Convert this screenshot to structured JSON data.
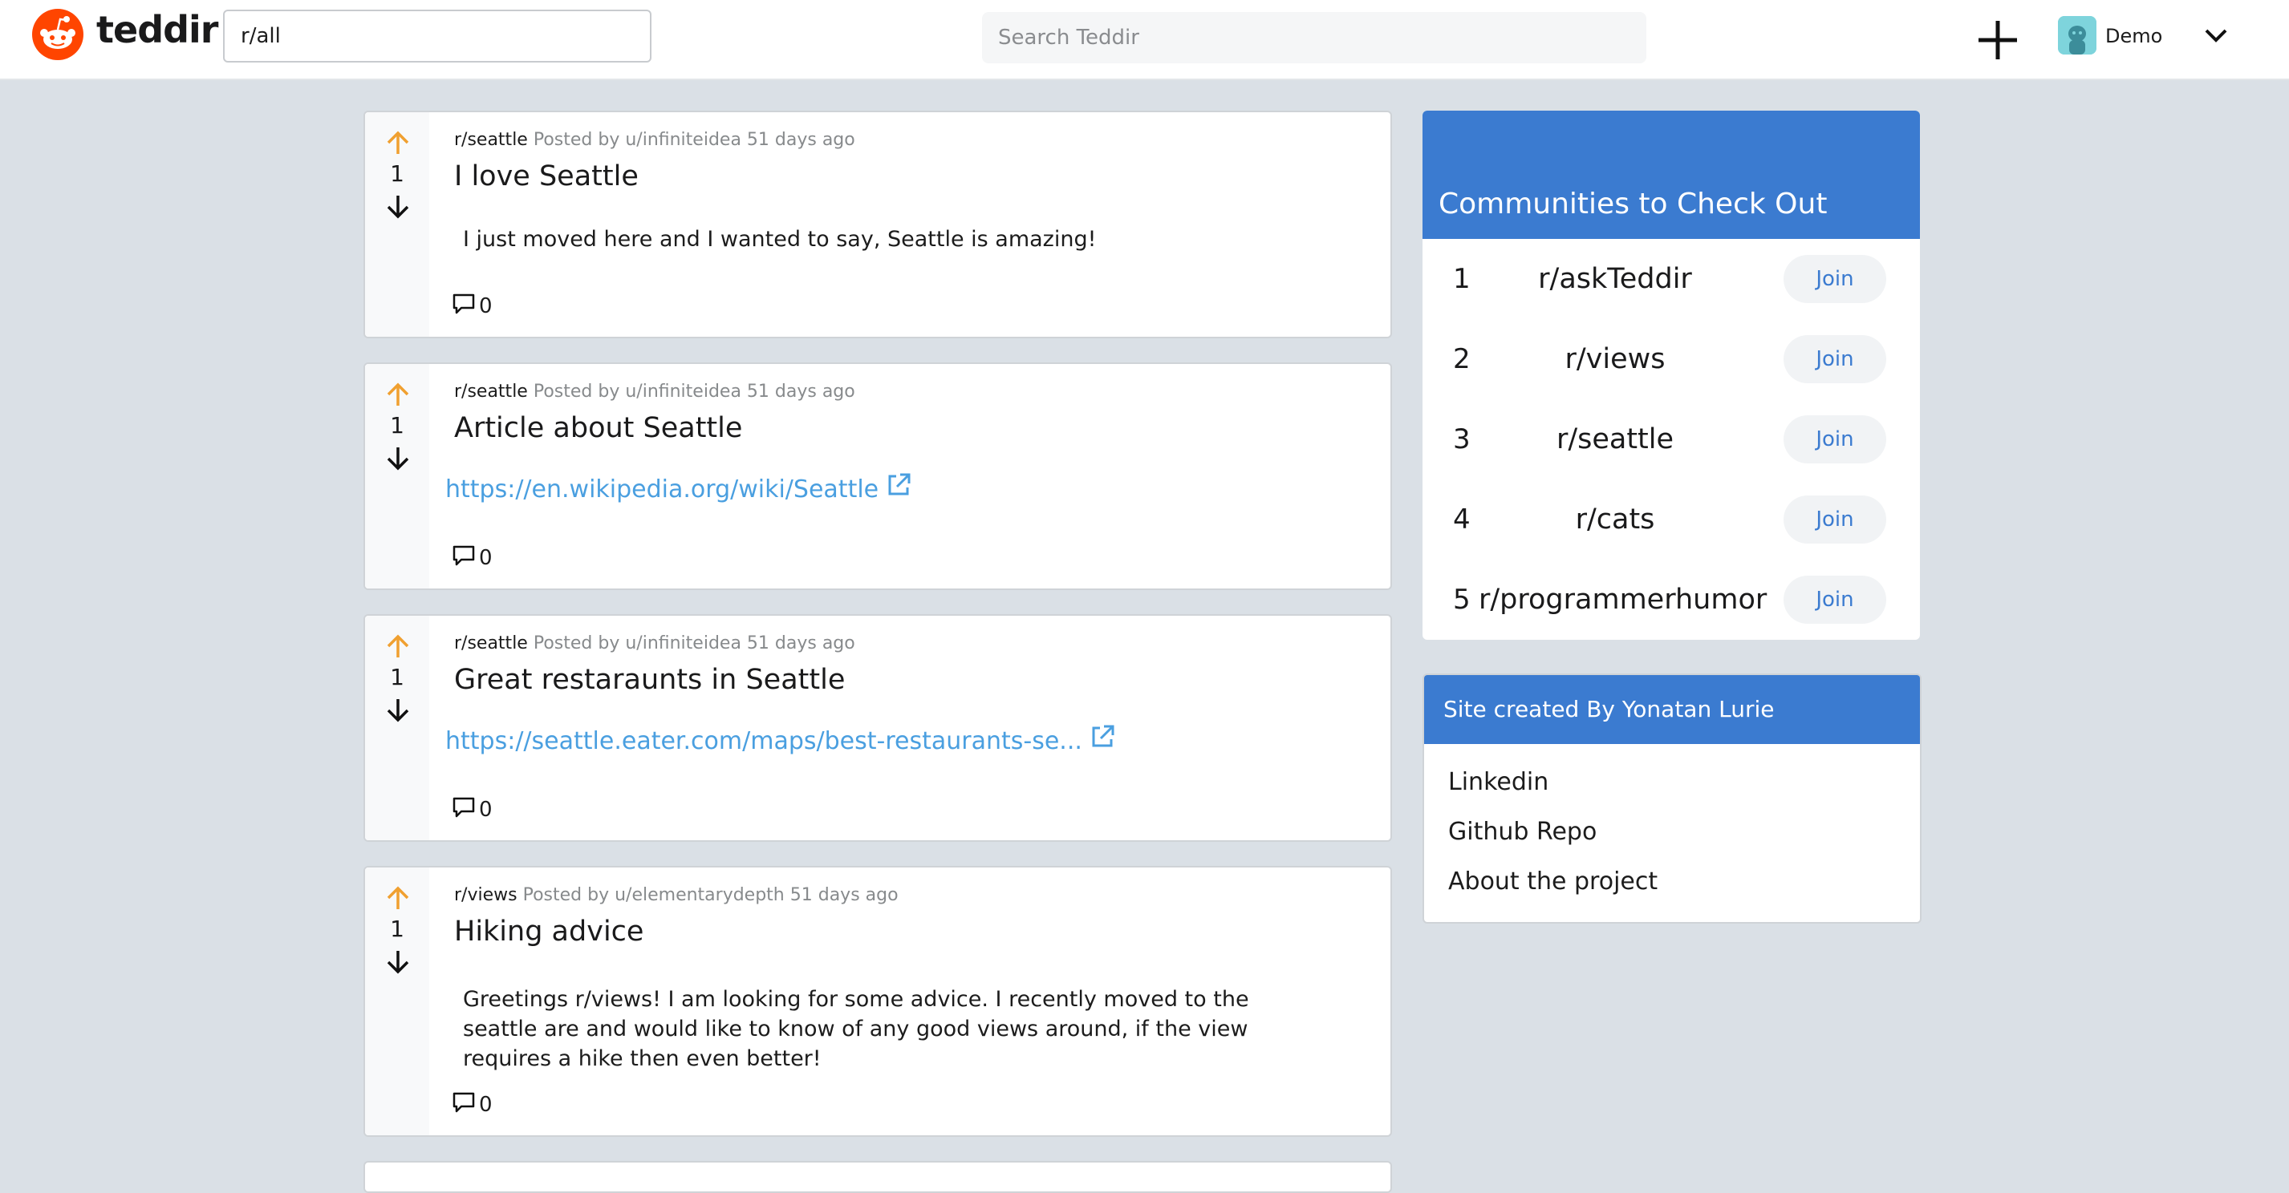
{
  "header": {
    "logo_text": "teddir",
    "subreddit_value": "r/all",
    "search_placeholder": "Search Teddir",
    "username": "Demo",
    "accent_color": "#ff4500"
  },
  "posts": [
    {
      "subreddit": "r/seattle",
      "posted_by": "Posted by u/infiniteidea 51 days ago",
      "votes": "1",
      "title": "I love Seattle",
      "body": "I just moved here and I wanted to say, Seattle is amazing!",
      "comments": "0"
    },
    {
      "subreddit": "r/seattle",
      "posted_by": "Posted by u/infiniteidea 51 days ago",
      "votes": "1",
      "title": "Article about Seattle",
      "link": "https://en.wikipedia.org/wiki/Seattle",
      "comments": "0"
    },
    {
      "subreddit": "r/seattle",
      "posted_by": "Posted by u/infiniteidea 51 days ago",
      "votes": "1",
      "title": "Great restaraunts in Seattle",
      "link": "https://seattle.eater.com/maps/best-restaurants-se...",
      "comments": "0"
    },
    {
      "subreddit": "r/views",
      "posted_by": "Posted by u/elementarydepth 51 days ago",
      "votes": "1",
      "title": "Hiking advice",
      "body": "Greetings r/views! I am looking for some advice. I recently moved to the seattle are and would like to know of any good views around, if the view requires a hike then even better!",
      "comments": "0"
    }
  ],
  "communities": {
    "title": "Communities to Check Out",
    "join_label": "Join",
    "items": [
      {
        "rank": "1",
        "name": "r/askTeddir"
      },
      {
        "rank": "2",
        "name": "r/views"
      },
      {
        "rank": "3",
        "name": "r/seattle"
      },
      {
        "rank": "4",
        "name": "r/cats"
      },
      {
        "rank": "5",
        "name": "r/programmerhumor"
      }
    ]
  },
  "about": {
    "title": "Site created By Yonatan Lurie",
    "links": [
      "Linkedin",
      "Github Repo",
      "About the project"
    ]
  },
  "colors": {
    "page_bg": "#dae0e6",
    "card_header": "#3b7bd0",
    "link": "#4a9fe0",
    "upvote": "#f0a030"
  }
}
